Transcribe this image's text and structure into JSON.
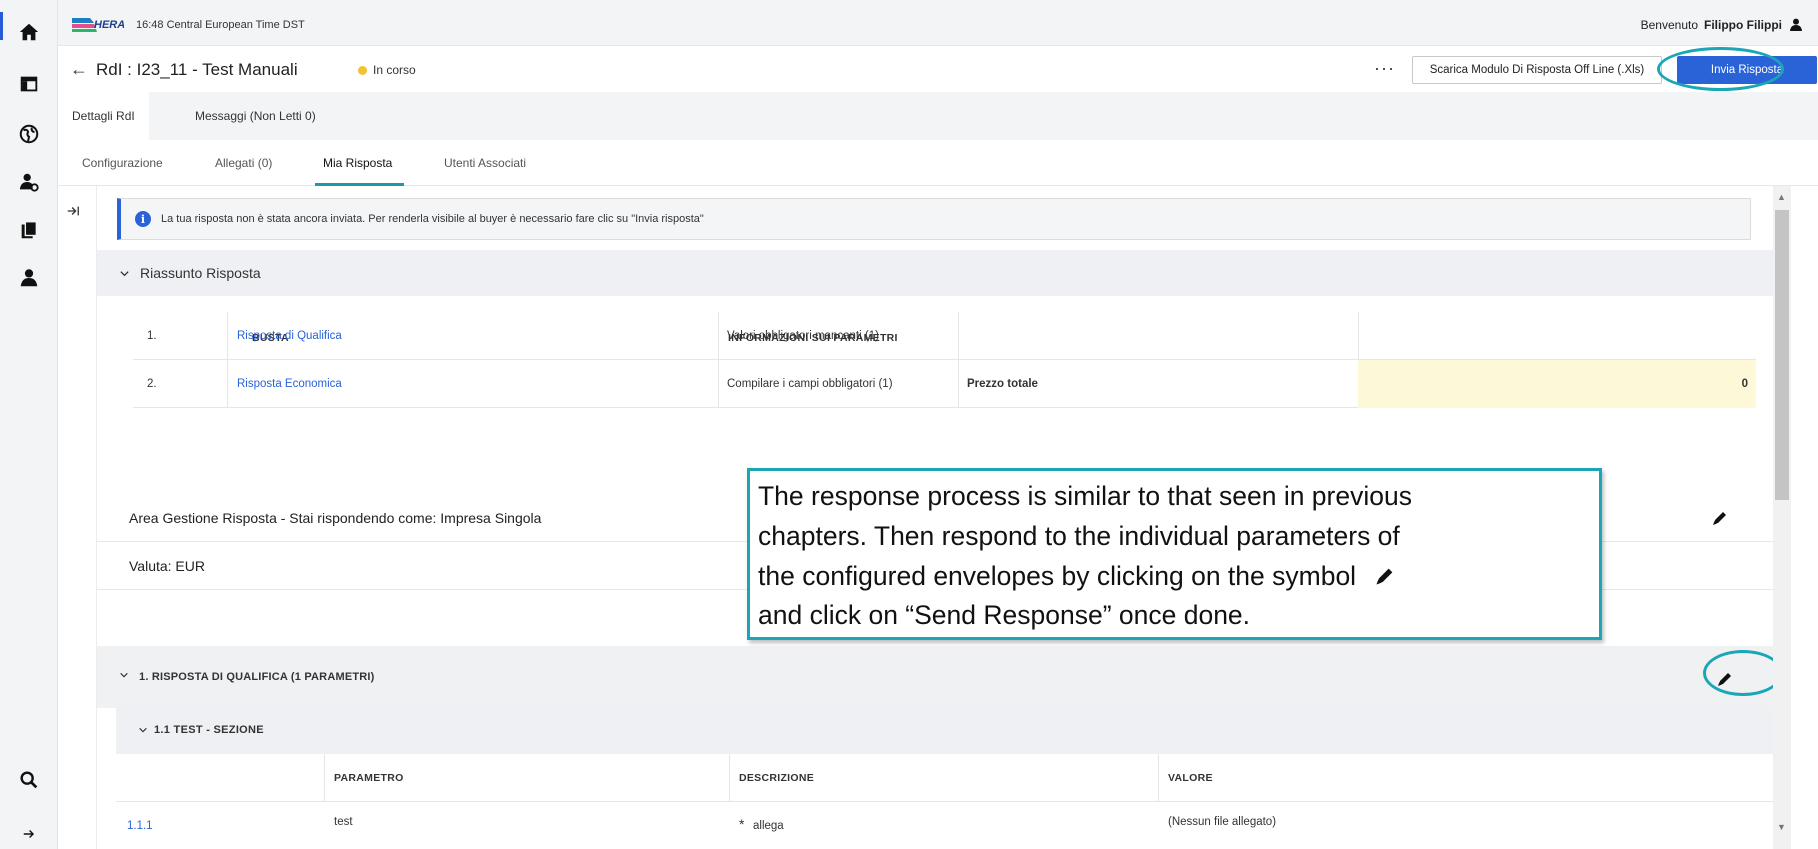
{
  "top": {
    "clock": "16:48 Central European Time DST",
    "welcome_prefix": "Benvenuto",
    "user_name": "Filippo Filippi"
  },
  "header": {
    "back_icon": "←",
    "title": "RdI : I23_11 - Test Manuali",
    "status": "In corso",
    "more": "···",
    "download_label": "Scarica Modulo Di Risposta Off Line (.Xls)",
    "send_label": "Invia Risposta"
  },
  "tabs_primary": [
    "Dettagli RdI",
    "Messaggi (Non Letti 0)"
  ],
  "tabs_secondary": [
    "Configurazione",
    "Allegati (0)",
    "Mia Risposta",
    "Utenti Associati"
  ],
  "banner": {
    "icon": "i",
    "text": "La tua risposta non è stata ancora inviata. Per renderla visibile al buyer è necessario fare clic su \"Invia risposta\""
  },
  "summary": {
    "title": "Riassunto Risposta",
    "col_busta": "BUSTA",
    "col_info": "INFORMAZIONI SUI PARAMETRI",
    "rows": [
      {
        "num": "1.",
        "busta": "Risposta di Qualifica",
        "info": "Valori obbligatori mancanti (1)",
        "label": "",
        "value": ""
      },
      {
        "num": "2.",
        "busta": "Risposta Economica",
        "info": "Compilare i campi obbligatori (1)",
        "label": "Prezzo totale",
        "value": "0"
      }
    ]
  },
  "area": {
    "management": "Area Gestione Risposta - Stai rispondendo come: Impresa Singola",
    "currency": "Valuta: EUR"
  },
  "section1": {
    "title": "1. RISPOSTA DI QUALIFICA (1 PARAMETRI)",
    "sub_title": "1.1  TEST - SEZIONE",
    "headers": [
      "PARAMETRO",
      "DESCRIZIONE",
      "VALORE"
    ],
    "row": {
      "id": "1.1.1",
      "param": "test",
      "req": "*",
      "desc": "allega",
      "value": "(Nessun file allegato)"
    }
  },
  "callout": {
    "line1": "The response process is similar to that seen in previous",
    "line2": "chapters. Then respond to the individual parameters of",
    "line3": "the configured envelopes by clicking on the symbol",
    "line4": "and click on “Send Response” once done."
  },
  "colors": {
    "accent": "#2a63d8",
    "highlight_ring": "#1aa6b5",
    "status_dot": "#f2c230",
    "yellow_cell": "#fdf8d8"
  },
  "icons": [
    "home-icon",
    "dashboard-icon",
    "globe-icon",
    "user-settings-icon",
    "documents-icon",
    "user-icon",
    "search-icon",
    "arrow-right-icon",
    "pencil-icon",
    "info-icon",
    "chevron-down-icon",
    "collapse-panel-icon"
  ]
}
